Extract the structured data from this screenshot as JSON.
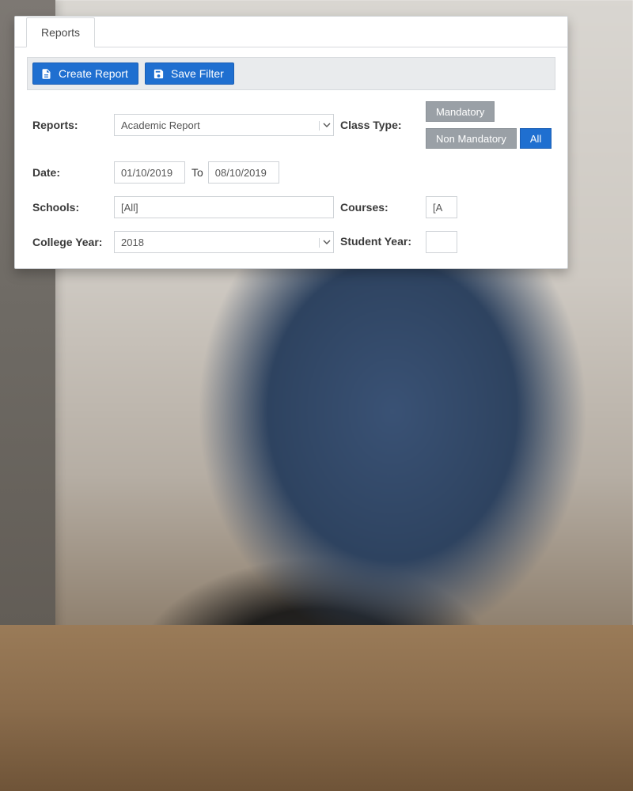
{
  "tab": {
    "label": "Reports"
  },
  "toolbar": {
    "create_label": "Create Report",
    "save_label": "Save Filter"
  },
  "filters": {
    "reports_label": "Reports:",
    "reports_value": "Academic Report",
    "date_label": "Date:",
    "date_from": "01/10/2019",
    "date_to_label": "To",
    "date_to": "08/10/2019",
    "schools_label": "Schools:",
    "schools_value": "[All]",
    "college_year_label": "College Year:",
    "college_year_value": "2018",
    "class_type_label": "Class Type:",
    "class_type_options": {
      "mandatory": "Mandatory",
      "non_mandatory": "Non Mandatory",
      "all": "All"
    },
    "courses_label": "Courses:",
    "courses_value": "[A",
    "student_year_label": "Student Year:"
  }
}
